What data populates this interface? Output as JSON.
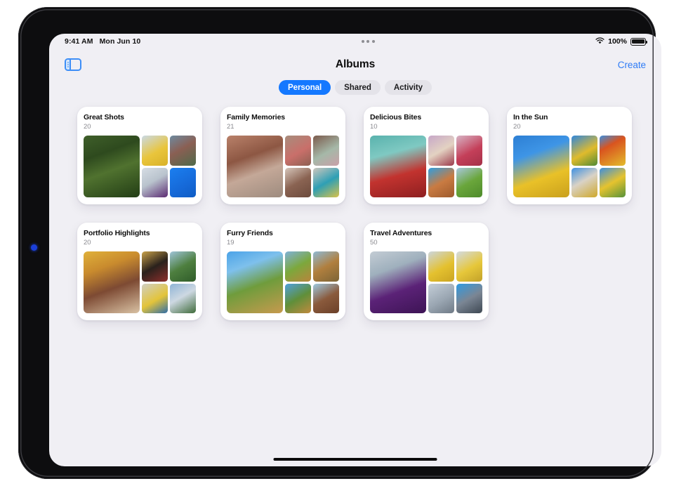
{
  "status_bar": {
    "time": "9:41 AM",
    "date": "Mon Jun 10",
    "battery_percent": "100%",
    "wifi_icon": "wifi-icon",
    "battery_icon": "battery-full-icon",
    "multitask_icon": "multitasking-dots-icon"
  },
  "nav": {
    "sidebar_toggle_icon": "sidebar-toggle-icon",
    "title": "Albums",
    "create_label": "Create"
  },
  "segmented_control": {
    "selected": "Personal",
    "accent_color": "#1478ff",
    "options": [
      {
        "label": "Personal",
        "selected": true
      },
      {
        "label": "Shared",
        "selected": false
      },
      {
        "label": "Activity",
        "selected": false
      }
    ]
  },
  "albums": [
    {
      "title": "Great Shots",
      "count": "20",
      "hero": {
        "name": "woman-in-green-foliage",
        "grad": "linear-gradient(160deg,#3f5f2a 0%,#2e4a1e 30%,#50722f 55%,#223d15 100%)"
      },
      "thumbs": [
        {
          "name": "yellow-skirt-climbing",
          "grad": "linear-gradient(150deg,#c9d9e6 0%,#e9c53c 55%,#d8b128 100%)"
        },
        {
          "name": "man-with-basketball",
          "grad": "linear-gradient(150deg,#6d8aa0 0%,#8a5f53 45%,#4e6a4a 100%)"
        },
        {
          "name": "purple-fabric-buildings",
          "grad": "linear-gradient(150deg,#d6dde4 0%,#b9c3cd 45%,#5b2a72 100%)"
        },
        {
          "name": "dog-jumping-blue-sky",
          "grad": "linear-gradient(150deg,#1b7ff0 0%,#1669d8 60%,#0f5cc4 100%)"
        }
      ]
    },
    {
      "title": "Family Memories",
      "count": "21",
      "hero": {
        "name": "three-siblings-smiling",
        "grad": "linear-gradient(160deg,#b9816a 0%,#8d5743 35%,#c4a898 60%,#9d8b7e 100%)"
      },
      "thumbs": [
        {
          "name": "mother-and-child-laughing",
          "grad": "linear-gradient(150deg,#a78d7d 0%,#c96f6a 55%,#8d6052 100%)"
        },
        {
          "name": "child-on-shoulder",
          "grad": "linear-gradient(150deg,#7b5a4c 0%,#a5b8a8 55%,#c9a0a8 100%)"
        },
        {
          "name": "family-group-hug",
          "grad": "linear-gradient(150deg,#d6c6bb 0%,#8a6352 50%,#6b4a3c 100%)"
        },
        {
          "name": "kids-playing-teal-shirt",
          "grad": "linear-gradient(150deg,#cfc6bc 0%,#2e9fb5 50%,#d9c24a 100%)"
        }
      ]
    },
    {
      "title": "Delicious Bites",
      "count": "10",
      "hero": {
        "name": "watermelon-and-raspberries",
        "grad": "linear-gradient(165deg,#59b2ad 0%,#7fc9c2 30%,#c2332f 62%,#8e1f20 100%)"
      },
      "thumbs": [
        {
          "name": "berry-layer-cake",
          "grad": "linear-gradient(150deg,#c7a7c8 0%,#e3d2c2 50%,#9c3a4b 100%)"
        },
        {
          "name": "raspberry-bowl-pink",
          "grad": "linear-gradient(150deg,#d7b4c5 0%,#c43f59 55%,#a43048 100%)"
        },
        {
          "name": "pizza-with-mozzarella",
          "grad": "linear-gradient(150deg,#2f9ee0 0%,#c97b42 50%,#9d5a2c 100%)"
        },
        {
          "name": "green-popsicle",
          "grad": "linear-gradient(150deg,#a9c8dd 0%,#6aa63b 50%,#4d8a2a 100%)"
        }
      ]
    },
    {
      "title": "In the Sun",
      "count": "20",
      "hero": {
        "name": "friends-circle-looking-down",
        "grad": "linear-gradient(160deg,#2d7fd4 0%,#3e95e6 30%,#e9c128 65%,#c9a01d 100%)"
      },
      "thumbs": [
        {
          "name": "person-lying-on-grass-yellow",
          "grad": "linear-gradient(150deg,#2f86dd 0%,#e0bb2c 55%,#4f8a35 100%)"
        },
        {
          "name": "playing-with-ball",
          "grad": "linear-gradient(150deg,#3a8fe0 0%,#d9541f 35%,#e3bd2c 100%)"
        },
        {
          "name": "two-friends-outdoors",
          "grad": "linear-gradient(150deg,#3e90e2 0%,#d9d2c6 45%,#cfa82a 100%)"
        },
        {
          "name": "person-reaching-up-sky",
          "grad": "linear-gradient(150deg,#3b8ee1 0%,#e6c32e 50%,#56923a 100%)"
        }
      ]
    },
    {
      "title": "Portfolio Highlights",
      "count": "20",
      "hero": {
        "name": "woman-reclining-yellow-curtain",
        "grad": "linear-gradient(160deg,#e0b13a 0%,#c98b2e 28%,#7d4a33 58%,#d9c2a4 100%)"
      },
      "thumbs": [
        {
          "name": "person-in-dark-doorway",
          "grad": "linear-gradient(150deg,#c9a24a 0%,#2a211c 50%,#8e2f2c 100%)"
        },
        {
          "name": "palm-tree-landscape",
          "grad": "linear-gradient(150deg,#9fc4d8 0%,#4e7f3f 50%,#2f5c2a 100%)"
        },
        {
          "name": "woman-in-yellow-dress",
          "grad": "linear-gradient(150deg,#cfcfc4 0%,#e3c43a 55%,#2f6ea8 100%)"
        },
        {
          "name": "clouds-over-field",
          "grad": "linear-gradient(150deg,#8fb4d6 0%,#cdd8e2 45%,#3f6b3a 100%)"
        }
      ]
    },
    {
      "title": "Furry Friends",
      "count": "19",
      "hero": {
        "name": "golden-retriever-in-field",
        "grad": "linear-gradient(160deg,#4ba3e8 0%,#7ec0ec 26%,#6f9c3c 55%,#c79a4e 100%)"
      },
      "thumbs": [
        {
          "name": "dog-with-person-sitting",
          "grad": "linear-gradient(150deg,#7fb2d8 0%,#7ca83c 50%,#b9843c 100%)"
        },
        {
          "name": "dog-howling-sky",
          "grad": "linear-gradient(150deg,#8fb9d4 0%,#b07f3e 50%,#7c6436 100%)"
        },
        {
          "name": "dog-sitting-in-grass",
          "grad": "linear-gradient(150deg,#4fa0dd 0%,#5f8f3a 50%,#c08a3e 100%)"
        },
        {
          "name": "horse-closeup",
          "grad": "linear-gradient(150deg,#9ec9e0 0%,#8a5a3c 50%,#6b4029 100%)"
        }
      ]
    },
    {
      "title": "Travel Adventures",
      "count": "50",
      "hero": {
        "name": "purple-scarf-city-skyline",
        "grad": "linear-gradient(160deg,#c3ccd4 0%,#9fb0bd 30%,#5b2277 62%,#3d1455 100%)"
      },
      "thumbs": [
        {
          "name": "yellow-coat-climbing",
          "grad": "linear-gradient(150deg,#ccd6de 0%,#e4c12f 55%,#caa422 100%)"
        },
        {
          "name": "yellow-pants-climber",
          "grad": "linear-gradient(150deg,#d3dbe2 0%,#e6c73a 55%,#c2a129 100%)"
        },
        {
          "name": "street-pole-cloudy-sky",
          "grad": "linear-gradient(150deg,#c4ced8 0%,#9aa6b2 55%,#6f7a86 100%)"
        },
        {
          "name": "two-people-jumping-city",
          "grad": "linear-gradient(150deg,#2f9ae2 0%,#7b8694 50%,#3d4752 100%)"
        }
      ]
    }
  ],
  "home_indicator": {
    "name": "home-indicator"
  }
}
